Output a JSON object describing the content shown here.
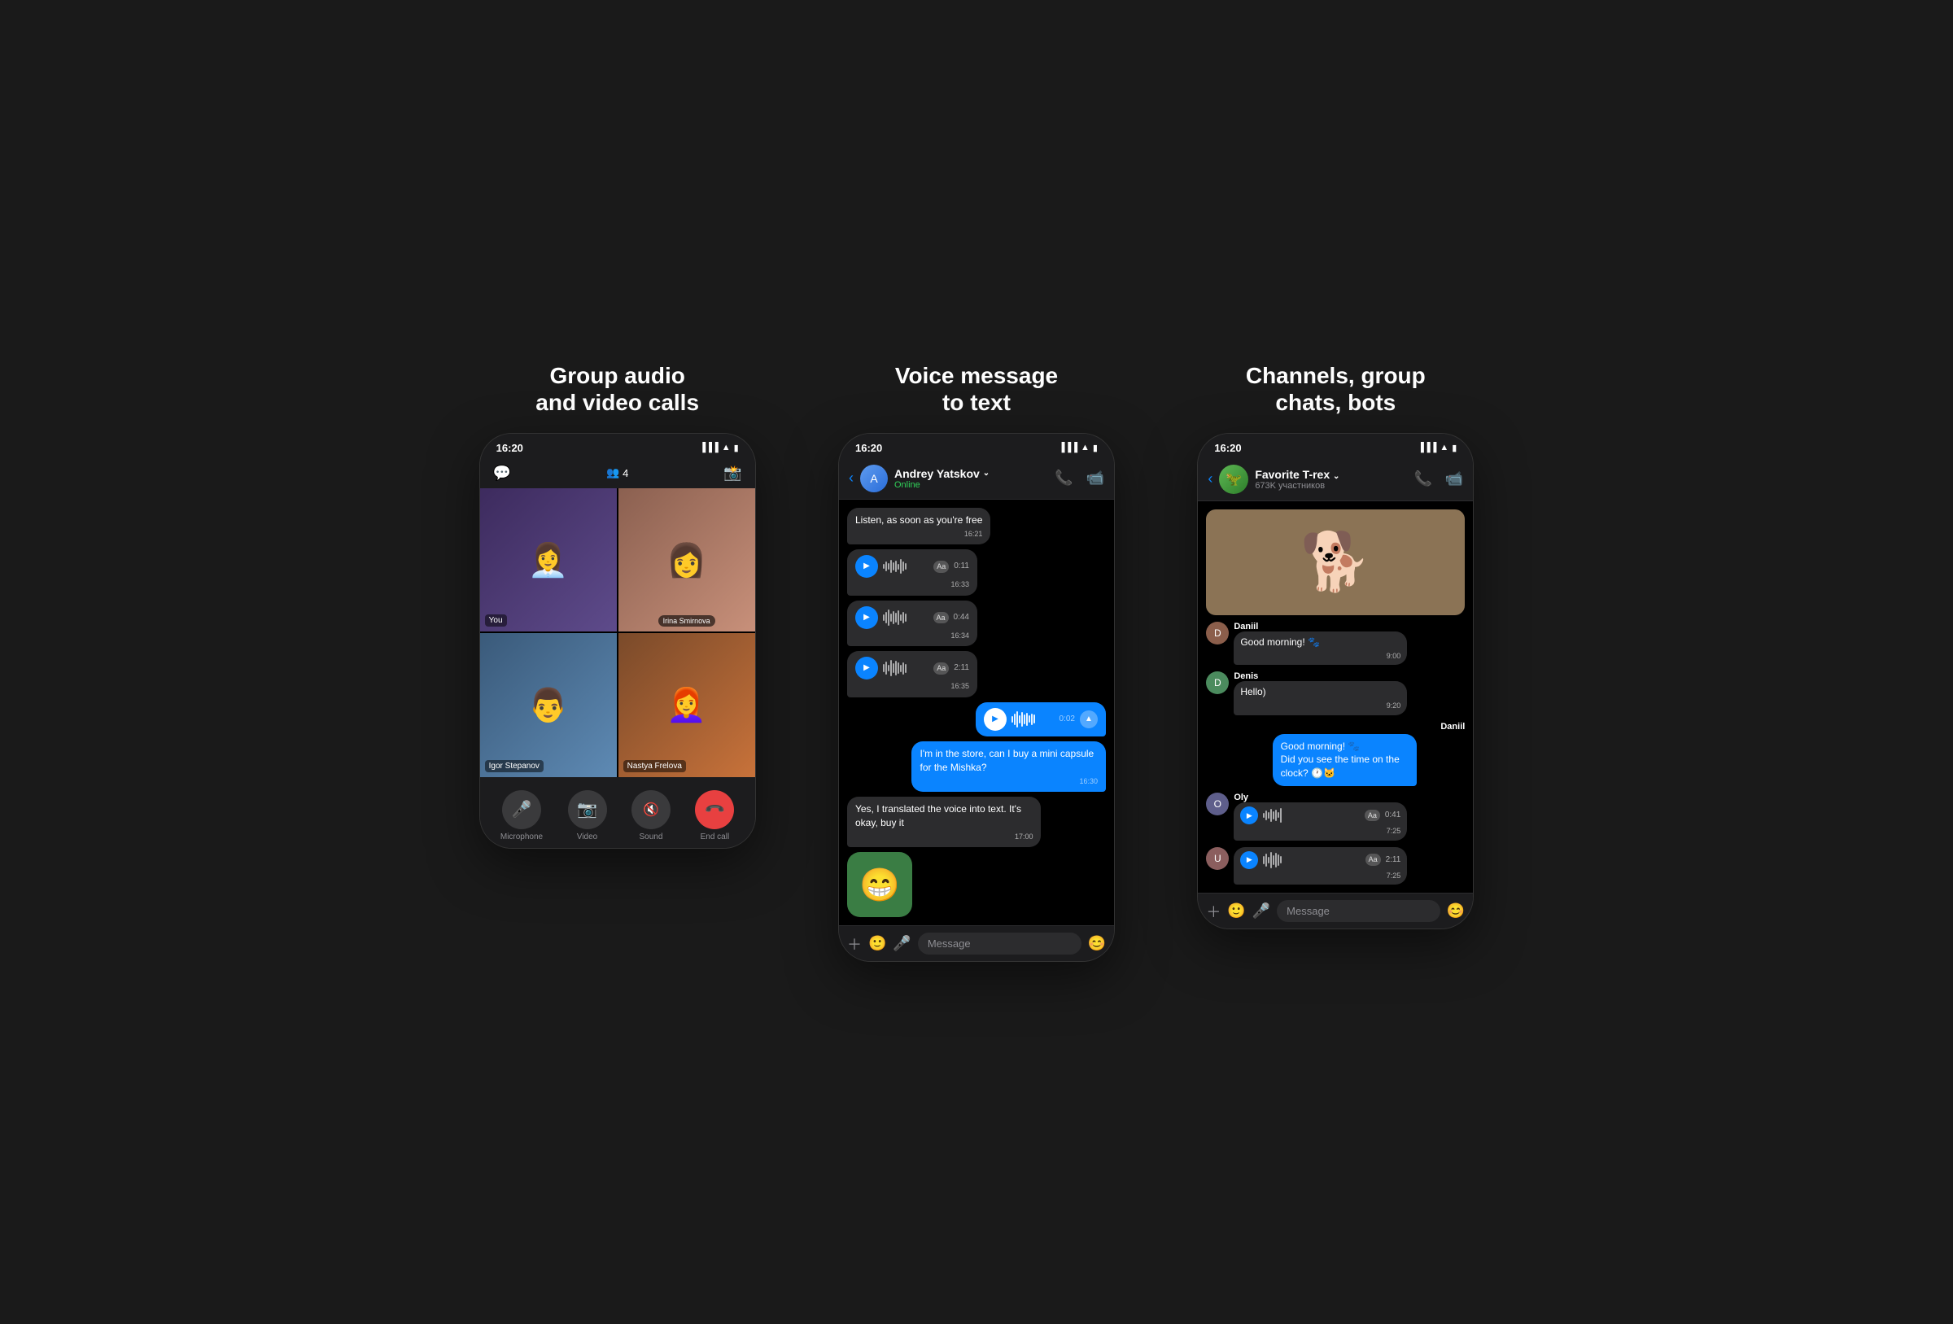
{
  "panel1": {
    "title": "Group audio\nand video calls",
    "status_time": "16:20",
    "participants_count": "4",
    "users": [
      {
        "name": "You",
        "emoji": "👩‍💼",
        "color": "#5e4b8b"
      },
      {
        "name": "Irina Smirnova",
        "emoji": "👩",
        "color": "#8b5e4b"
      },
      {
        "name": "Igor Stepanov",
        "emoji": "👨",
        "color": "#4b6b8b"
      },
      {
        "name": "Nastya Frelova",
        "emoji": "👩‍🦰",
        "color": "#c8723a"
      }
    ],
    "controls": [
      {
        "label": "Microphone",
        "icon": "🎤",
        "color": "gray"
      },
      {
        "label": "Video",
        "icon": "📷",
        "color": "gray"
      },
      {
        "label": "Sound",
        "icon": "🔇",
        "color": "gray"
      },
      {
        "label": "End call",
        "icon": "📞",
        "color": "red"
      }
    ]
  },
  "panel2": {
    "title": "Voice message\nto text",
    "status_time": "16:20",
    "chat_name": "Andrey Yatskov",
    "chat_status": "Online",
    "messages": [
      {
        "type": "received",
        "text": "Listen, as soon as you're free",
        "time": "16:21"
      },
      {
        "type": "voice_received",
        "duration": "0:11",
        "time": "16:33"
      },
      {
        "type": "voice_received",
        "duration": "0:44",
        "time": "16:34"
      },
      {
        "type": "voice_received",
        "duration": "2:11",
        "time": "16:35"
      },
      {
        "type": "voice_sent_active",
        "duration": "0:02",
        "time": ""
      },
      {
        "type": "sent",
        "text": "I'm in the store, can I buy a mini capsule for the Mishka?",
        "time": "16:30"
      },
      {
        "type": "received",
        "text": "Yes, I translated the voice into text. It's okay, buy it",
        "time": "17:00"
      }
    ],
    "input_placeholder": "Message"
  },
  "panel3": {
    "title": "Channels, group\nchats, bots",
    "status_time": "16:20",
    "channel_name": "Favorite T-rex",
    "channel_members": "673K участников",
    "messages": [
      {
        "type": "image",
        "emoji": "🐕"
      },
      {
        "type": "text",
        "username": "Daniil",
        "text": "Good morning! 🐾",
        "time": "9:00",
        "avatar_color": "#8b5e4b"
      },
      {
        "type": "text",
        "username": "Denis",
        "text": "Hello)",
        "time": "9:20",
        "avatar_color": "#4b8b5e"
      },
      {
        "type": "sent_block",
        "username": "Daniil",
        "text": "Good morning! 🐾\nDid you see the time on the clock? 🕐🐱",
        "time": ""
      },
      {
        "type": "oly_voice",
        "username": "Oly",
        "duration": "0:41",
        "time": "7:25",
        "avatar_color": "#5e5e8b"
      },
      {
        "type": "voice",
        "duration": "2:11",
        "time": "7:25",
        "avatar_color": "#8b5e5e"
      }
    ],
    "input_placeholder": "Message"
  }
}
